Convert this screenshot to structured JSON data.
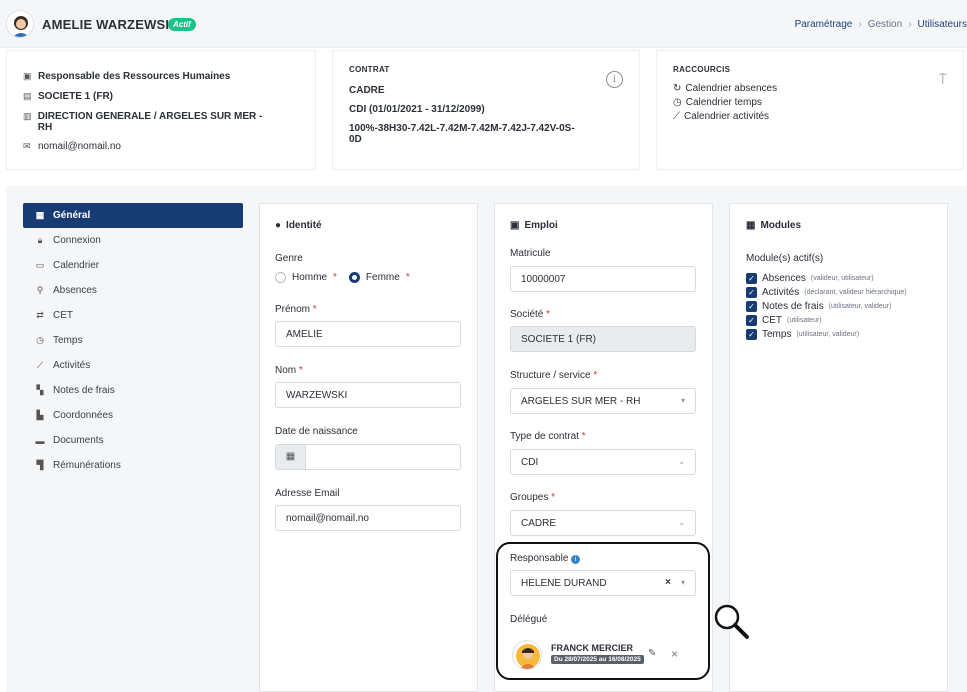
{
  "header": {
    "user_name": "AMELIE WARZEWSKI",
    "status_badge": "Actif",
    "breadcrumb": [
      "Paramétrage",
      "Gestion",
      "Utilisateurs"
    ]
  },
  "summary_profile": {
    "job_title": "Responsable des Ressources Humaines",
    "company": "SOCIETE 1 (FR)",
    "department": "DIRECTION GENERALE / ARGELES SUR MER - RH",
    "email": "nomail@nomail.no"
  },
  "summary_contract": {
    "label": "CONTRAT",
    "category": "CADRE",
    "contract": "CDI (01/01/2021 - 31/12/2099)",
    "schedule": "100%-38H30-7.42L-7.42M-7.42M-7.42J-7.42V-0S-0D"
  },
  "summary_shortcuts": {
    "label": "RACCOURCIS",
    "items": [
      "Calendrier absences",
      "Calendrier temps",
      "Calendrier activités"
    ]
  },
  "sidebar": {
    "items": [
      {
        "label": "Général",
        "active": true
      },
      {
        "label": "Connexion"
      },
      {
        "label": "Calendrier"
      },
      {
        "label": "Absences"
      },
      {
        "label": "CET"
      },
      {
        "label": "Temps"
      },
      {
        "label": "Activités"
      },
      {
        "label": "Notes de frais"
      },
      {
        "label": "Coordonnées"
      },
      {
        "label": "Documents"
      },
      {
        "label": "Rémunérations"
      }
    ]
  },
  "identity": {
    "title": "Identité",
    "genre_label": "Genre",
    "genre_options": [
      "Homme",
      "Femme"
    ],
    "genre_selected": "Femme",
    "firstname_label": "Prénom",
    "firstname_value": "AMELIE",
    "lastname_label": "Nom",
    "lastname_value": "WARZEWSKI",
    "birthdate_label": "Date de naissance",
    "birthdate_value": "",
    "email_label": "Adresse Email",
    "email_value": "nomail@nomail.no"
  },
  "employment": {
    "title": "Emploi",
    "matricule_label": "Matricule",
    "matricule_value": "10000007",
    "company_label": "Société",
    "company_value": "SOCIETE 1 (FR)",
    "structure_label": "Structure / service",
    "structure_value": "ARGELES SUR MER - RH",
    "contract_type_label": "Type de contrat",
    "contract_type_value": "CDI",
    "groups_label": "Groupes",
    "groups_value": "CADRE",
    "manager_label": "Responsable",
    "manager_value": "HELENE DURAND",
    "delegate_label": "Délégué",
    "delegate_name": "FRANCK MERCIER",
    "delegate_dates": "Du 28/07/2025 au 16/08/2025"
  },
  "modules": {
    "title": "Modules",
    "subtitle": "Module(s) actif(s)",
    "items": [
      {
        "name": "Absences",
        "hint": "(valideur, utilisateur)"
      },
      {
        "name": "Activités",
        "hint": "(déclarant, valideur hiérarchique)"
      },
      {
        "name": "Notes de frais",
        "hint": "(utilisateur, valideur)"
      },
      {
        "name": "CET",
        "hint": "(utilisateur)"
      },
      {
        "name": "Temps",
        "hint": "(utilisateur, valideur)"
      }
    ]
  },
  "colors": {
    "primary": "#173b73",
    "badge_green": "#20c08a",
    "required_red": "#e03131",
    "background": "#f5f6f8"
  }
}
